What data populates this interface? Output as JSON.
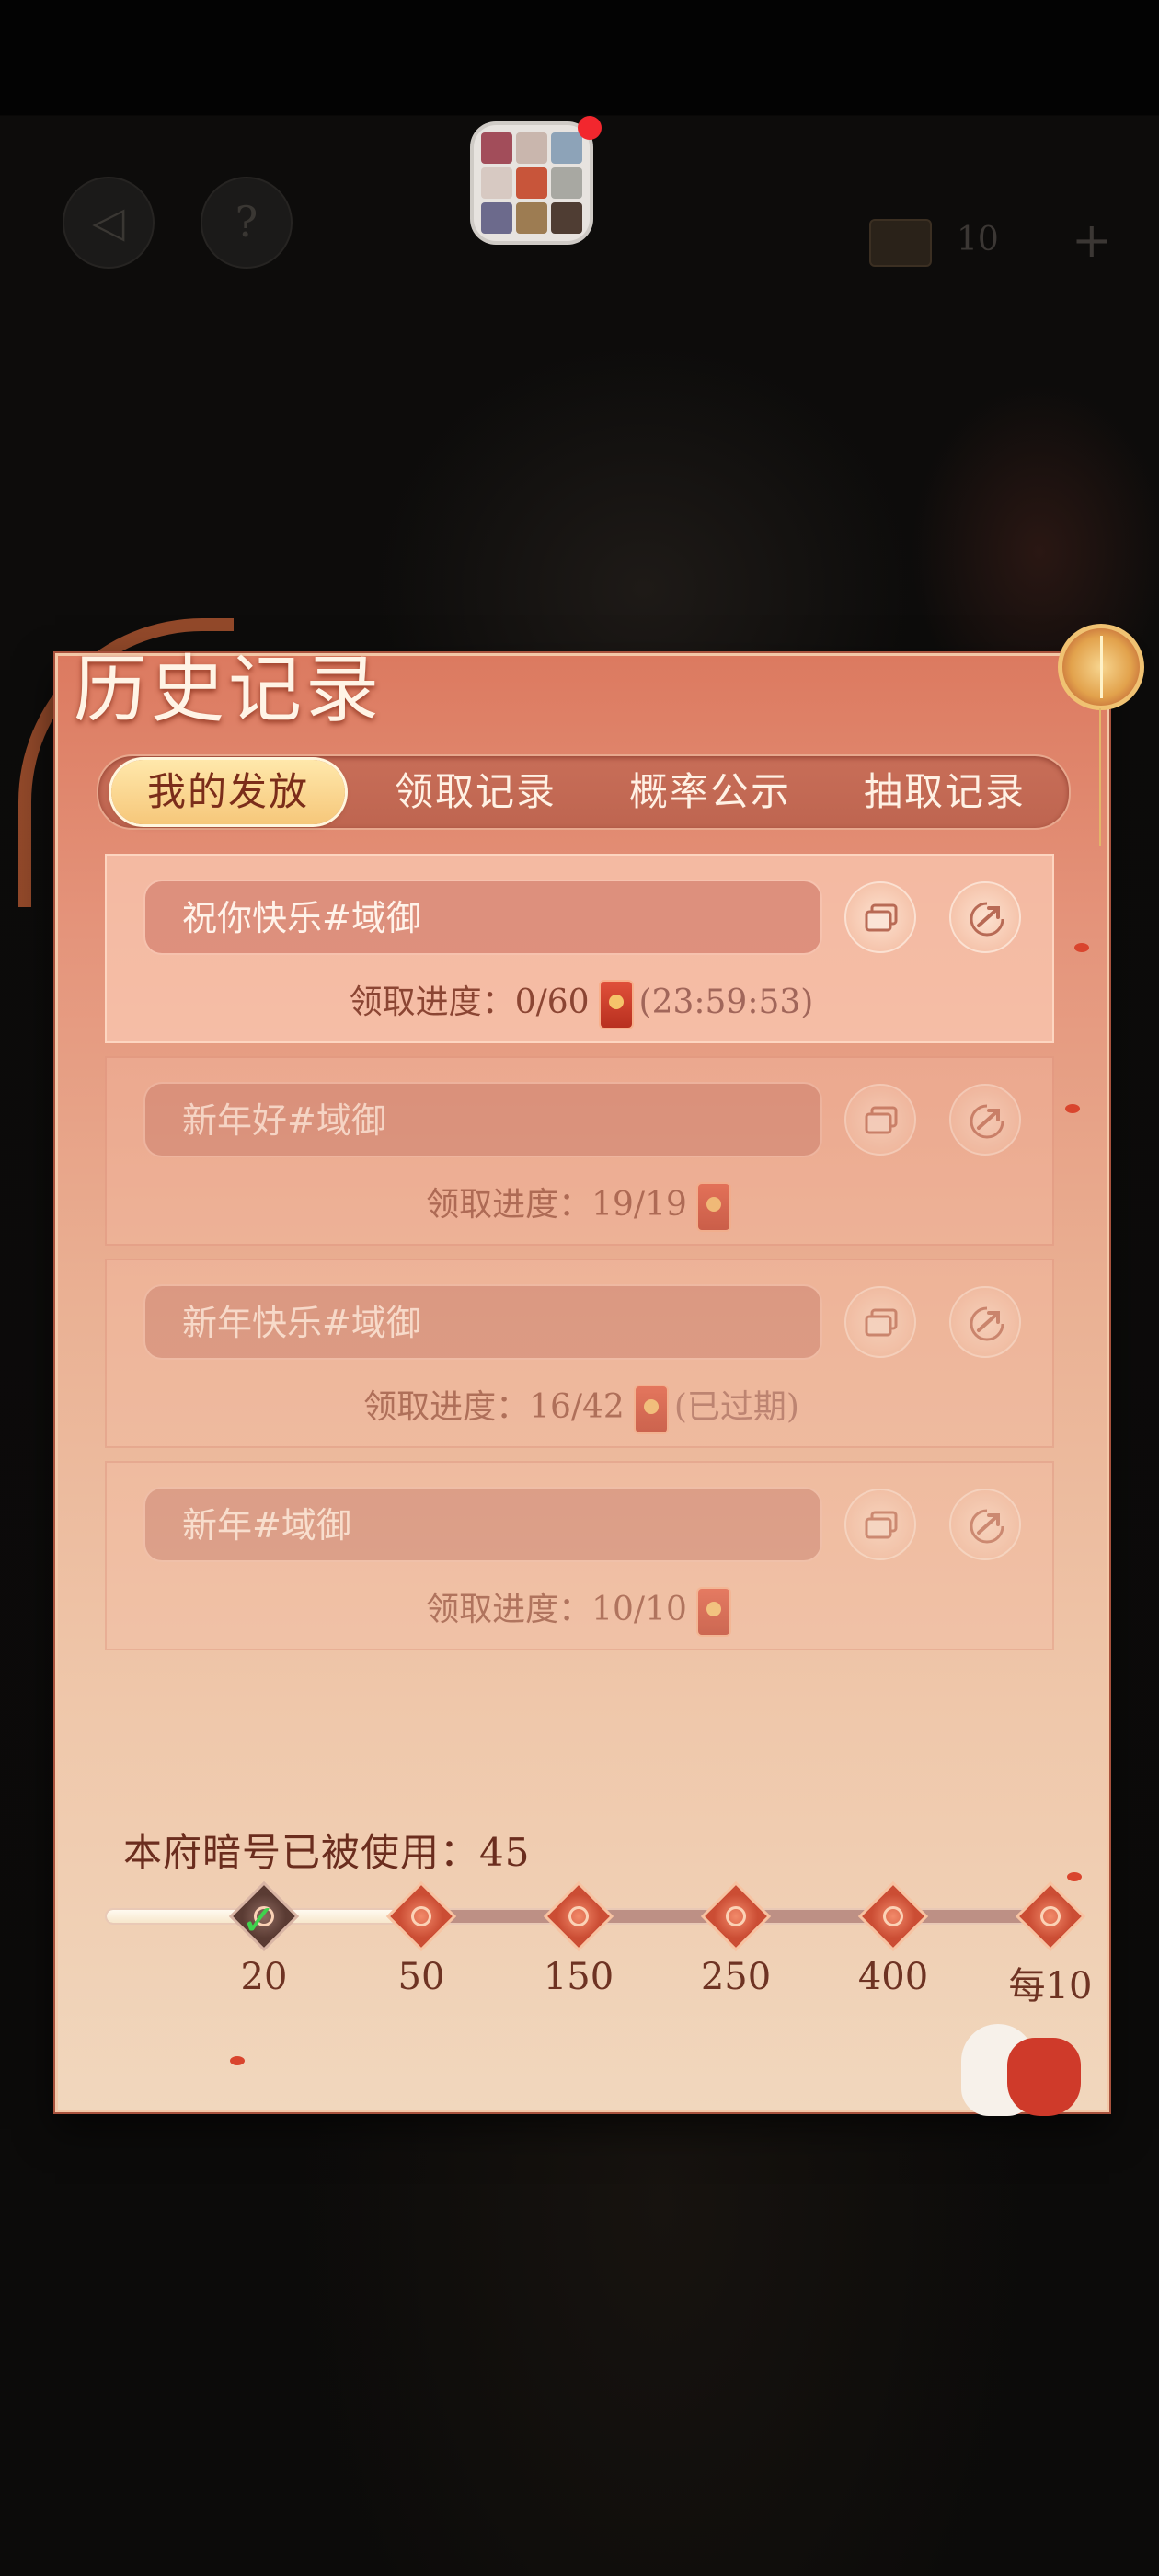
{
  "hud": {
    "back_icon": "back-arrow-icon",
    "help_label": "?",
    "currency_count": "10",
    "add_label": "+"
  },
  "panel": {
    "title": "历史记录"
  },
  "tabs": [
    {
      "label": "我的发放",
      "active": true
    },
    {
      "label": "领取记录",
      "active": false
    },
    {
      "label": "概率公示",
      "active": false
    },
    {
      "label": "抽取记录",
      "active": false
    }
  ],
  "records": [
    {
      "message": "祝你快乐#域御",
      "progress_label": "领取进度：",
      "progress": "0/60",
      "status": "(23:59:53)"
    },
    {
      "message": "新年好#域御",
      "progress_label": "领取进度：",
      "progress": "19/19",
      "status": ""
    },
    {
      "message": "新年快乐#域御",
      "progress_label": "领取进度：",
      "progress": "16/42",
      "status": "(已过期)"
    },
    {
      "message": "新年#域御",
      "progress_label": "领取进度：",
      "progress": "10/10",
      "status": ""
    }
  ],
  "usage": {
    "label": "本府暗号已被使用：",
    "count": "45"
  },
  "milestones": [
    "20",
    "50",
    "150",
    "250",
    "400",
    "每10"
  ],
  "colors": {
    "panel_top": "#dc7a60",
    "panel_bottom": "#f1d7bd",
    "active_tab": "#f6c77a",
    "check_green": "#3fd24e"
  }
}
